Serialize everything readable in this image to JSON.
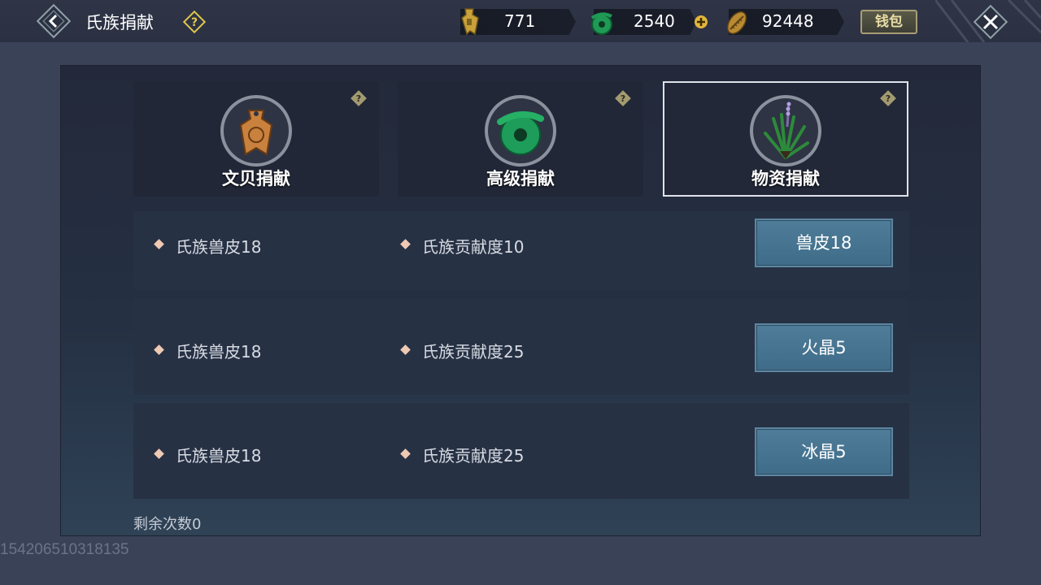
{
  "header": {
    "title": "氏族捐献",
    "wallet_label": "钱包"
  },
  "resources": [
    {
      "icon": "bronze-spade-coin-icon",
      "value": "771"
    },
    {
      "icon": "jade-coin-icon",
      "value": "2540"
    },
    {
      "icon": "shell-coin-icon",
      "value": "92448"
    }
  ],
  "tabs": [
    {
      "label": "文贝捐献",
      "icon": "bronze-coin-icon",
      "active": false
    },
    {
      "label": "高级捐献",
      "icon": "jade-disc-icon",
      "active": false
    },
    {
      "label": "物资捐献",
      "icon": "herb-plant-icon",
      "active": true
    }
  ],
  "rows": [
    {
      "reward1": "氏族兽皮18",
      "reward2": "氏族贡献度10",
      "button": "兽皮18"
    },
    {
      "reward1": "氏族兽皮18",
      "reward2": "氏族贡献度25",
      "button": "火晶5"
    },
    {
      "reward1": "氏族兽皮18",
      "reward2": "氏族贡献度25",
      "button": "冰晶5"
    }
  ],
  "remaining_label": "剩余次数0",
  "uid": "154206510318135",
  "colors": {
    "accent_button": "#447390",
    "panel_bg": "#252c3d",
    "wallet_border": "#a69d74"
  }
}
